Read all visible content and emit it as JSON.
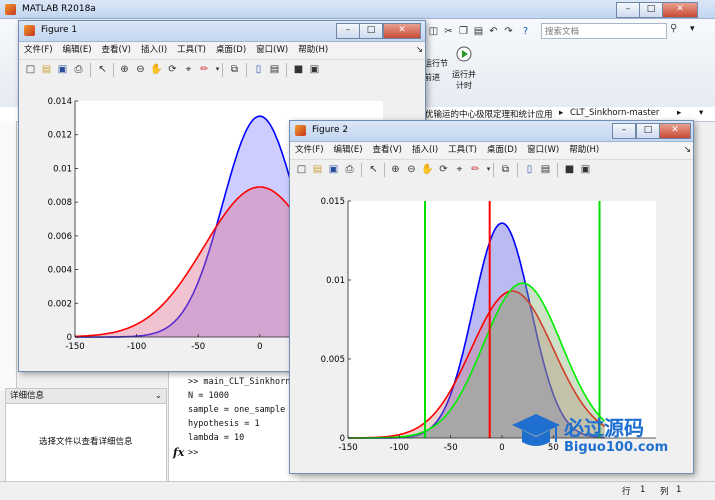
{
  "main_window": {
    "title": "MATLAB R2018a",
    "search_placeholder": "搜索文档",
    "ribbon_run_section": "运行节",
    "ribbon_advance": "前进",
    "ribbon_run_time_line1": "运行并",
    "ribbon_run_time_line2": "计时",
    "path_segment_1": "优输运的中心极限定理和统计应用",
    "path_segment_2": "CLT_Sinkhorn-master",
    "details_header": "详细信息",
    "details_placeholder": "选择文件以查看详细信息",
    "command_lines": [
      ">> main_CLT_Sinkhorn",
      "N = 1000",
      "sample = one_sample",
      "hypothesis = 1",
      "lambda = 10"
    ],
    "prompt_label": "fx",
    "prompt": ">>",
    "status_row_label": "行",
    "status_row_value": "1",
    "status_col_label": "列",
    "status_col_value": "1"
  },
  "figure_menu": [
    "文件(F)",
    "编辑(E)",
    "查看(V)",
    "插入(I)",
    "工具(T)",
    "桌面(D)",
    "窗口(W)",
    "帮助(H)"
  ],
  "figure1": {
    "title": "Figure 1",
    "chart_data": {
      "type": "area",
      "x_range": [
        -150,
        60
      ],
      "xlim": [
        -150,
        100
      ],
      "ylim": [
        0,
        0.014
      ],
      "xticks": [
        "-150",
        "-100",
        "-50",
        "0",
        "50"
      ],
      "yticks": [
        "0",
        "0.002",
        "0.004",
        "0.006",
        "0.008",
        "0.01",
        "0.012",
        "0.014"
      ],
      "series": [
        {
          "color": "#0000ff",
          "fill": "#c8c8ff",
          "mean": 0,
          "sd": 30,
          "peak": 0.0131
        },
        {
          "color": "#ff0000",
          "fill": "rgba(220,110,140,0.55)",
          "mean": 0,
          "sd": 45,
          "peak": 0.0089
        }
      ]
    }
  },
  "figure2": {
    "title": "Figure 2",
    "chart_data": {
      "type": "area",
      "x_range": [
        -150,
        100
      ],
      "xlim": [
        -150,
        150
      ],
      "ylim": [
        0,
        0.015
      ],
      "xticks": [
        "-150",
        "-100",
        "-50",
        "0",
        "50"
      ],
      "yticks": [
        "0",
        "0.005",
        "0.01",
        "0.015"
      ],
      "series": [
        {
          "color": "#0000ff",
          "fill": "#b4b4f0",
          "mean": 0,
          "sd": 28,
          "peak": 0.0136
        },
        {
          "color": "#ff0000",
          "fill": "rgba(200,120,120,0.45)",
          "mean": 10,
          "sd": 40,
          "peak": 0.0093
        },
        {
          "color": "#00ee00",
          "fill": "rgba(130,170,110,0.5)",
          "mean": 20,
          "sd": 38,
          "peak": 0.0098
        }
      ],
      "vlines": [
        {
          "x": -75,
          "color": "#00e000"
        },
        {
          "x": -12,
          "color": "#ff0000"
        },
        {
          "x": 95,
          "color": "#00e000"
        }
      ]
    }
  },
  "watermark": {
    "line1": "必过源码",
    "line2": "Biguo100.com"
  }
}
